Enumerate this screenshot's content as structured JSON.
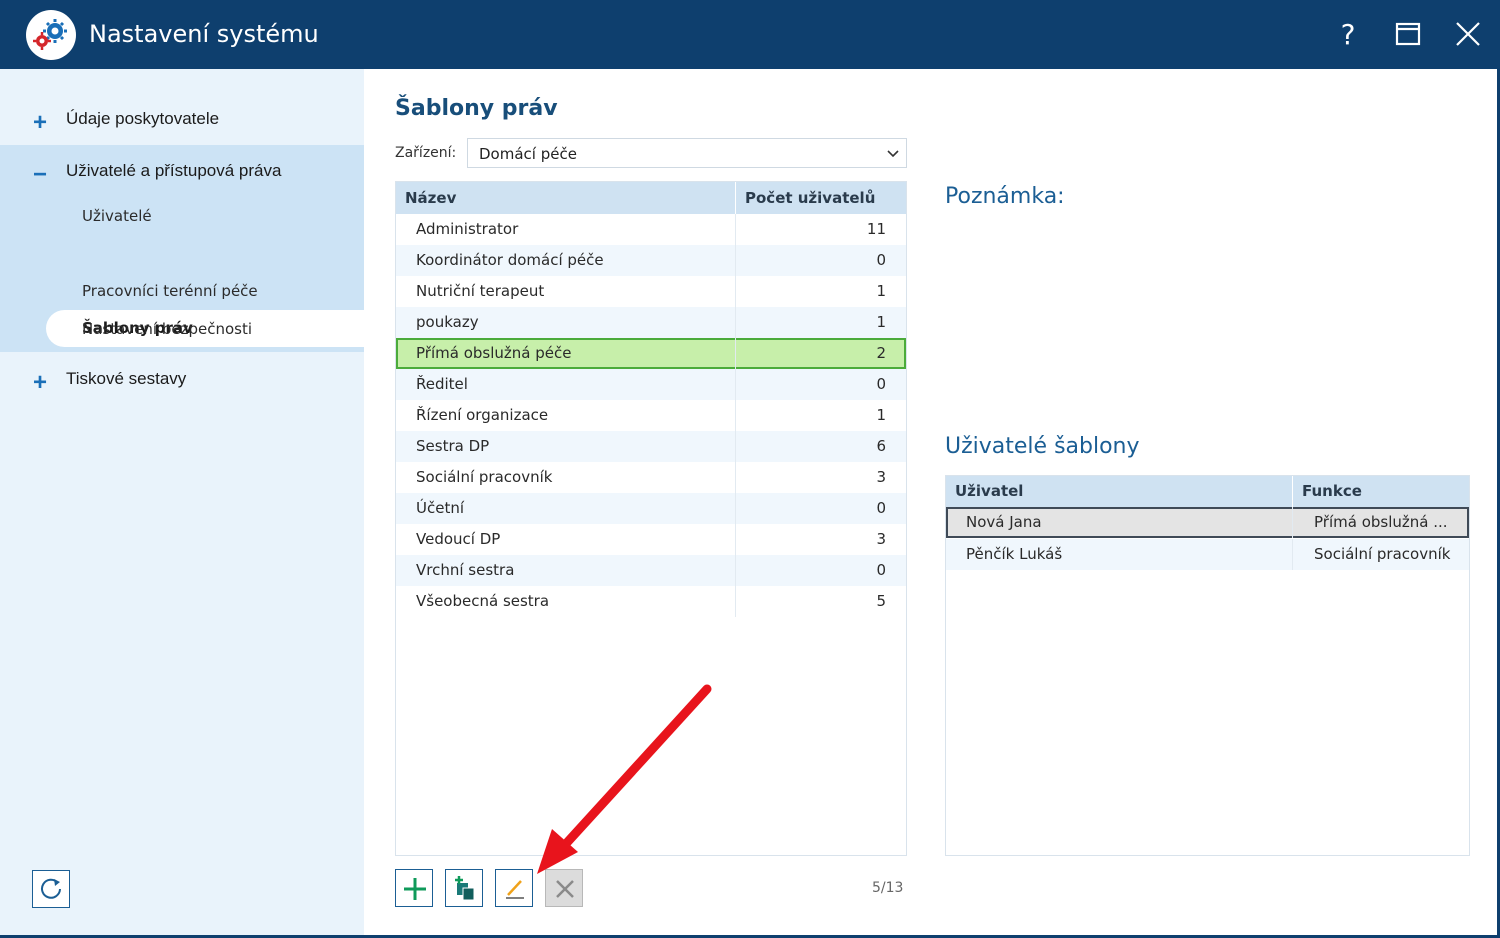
{
  "window": {
    "title": "Nastavení systému",
    "help_label": "?"
  },
  "sidebar": {
    "groups": [
      {
        "sign": "+",
        "label": "Údaje poskytovatele"
      },
      {
        "sign": "−",
        "label": "Uživatelé a přístupová práva"
      },
      {
        "sign": "+",
        "label": "Tiskové sestavy"
      }
    ],
    "sub_items": [
      {
        "label": "Uživatelé"
      },
      {
        "label": "Šablony práv"
      },
      {
        "label": "Pracovníci terénní péče"
      },
      {
        "label": "Nastavení bezpečnosti"
      }
    ]
  },
  "main": {
    "title": "Šablony práv",
    "device_label": "Zařízení:",
    "device_value": "Domácí péče",
    "table": {
      "headers": [
        "Název",
        "Počet uživatelů"
      ],
      "rows": [
        {
          "name": "Administrator",
          "count": "11"
        },
        {
          "name": "Koordinátor domácí péče",
          "count": "0"
        },
        {
          "name": "Nutriční terapeut",
          "count": "1"
        },
        {
          "name": "poukazy",
          "count": "1"
        },
        {
          "name": "Přímá obslužná péče",
          "count": "2"
        },
        {
          "name": "Ředitel",
          "count": "0"
        },
        {
          "name": "Řízení organizace",
          "count": "1"
        },
        {
          "name": "Sestra DP",
          "count": "6"
        },
        {
          "name": "Sociální pracovník",
          "count": "3"
        },
        {
          "name": "Účetní",
          "count": "0"
        },
        {
          "name": "Vedoucí DP",
          "count": "3"
        },
        {
          "name": "Vrchní sestra",
          "count": "0"
        },
        {
          "name": "Všeobecná sestra",
          "count": "5"
        }
      ],
      "selected_index": 4
    },
    "pager": "5/13"
  },
  "right": {
    "note_label": "Poznámka:",
    "users_title": "Uživatelé šablony",
    "users_table": {
      "headers": [
        "Uživatel",
        "Funkce"
      ],
      "rows": [
        {
          "name": "Nová Jana",
          "function": "Přímá obslužná ..."
        },
        {
          "name": "Pěnčík Lukáš",
          "function": "Sociální pracovník"
        }
      ],
      "selected_index": 0
    }
  },
  "colors": {
    "titlebar": "#0e3f6e",
    "accent": "#1b5e94",
    "selected_row": "#c7efaa",
    "arrow": "#e8141c"
  }
}
